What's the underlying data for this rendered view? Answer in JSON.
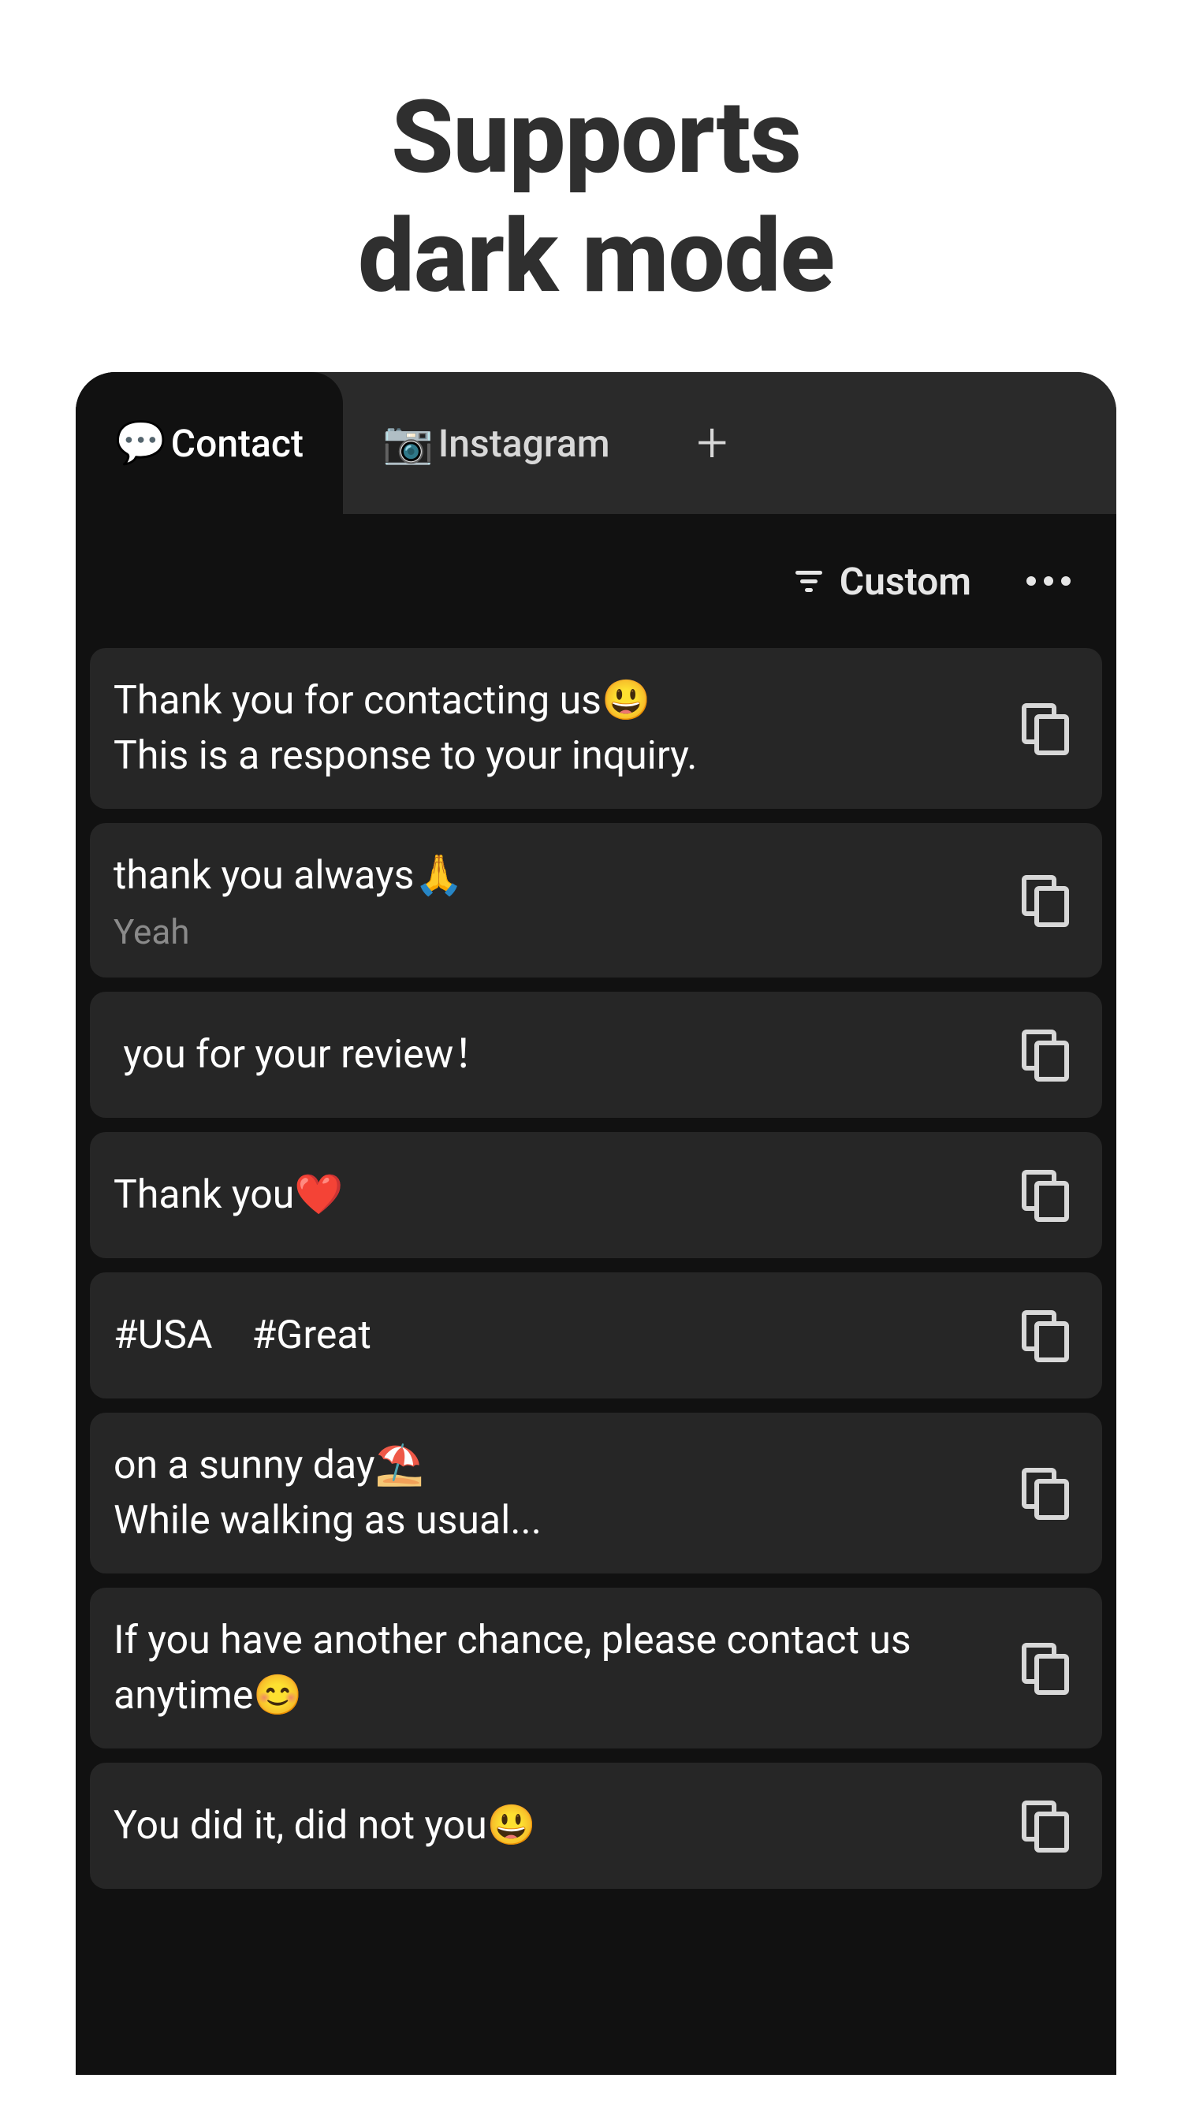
{
  "headline_line1": "Supports",
  "headline_line2": "dark mode",
  "tabs": [
    {
      "icon": "💬",
      "label": "Contact",
      "active": true
    },
    {
      "icon": "📷",
      "label": "Instagram",
      "active": false
    }
  ],
  "toolbar": {
    "filter_label": "Custom"
  },
  "items": [
    {
      "text": "Thank you for contacting us😃\nThis is a response to your inquiry.",
      "sub": null
    },
    {
      "text": "thank you always🙏",
      "sub": "Yeah"
    },
    {
      "text": " you for your review！",
      "sub": null
    },
    {
      "text": "Thank you❤️",
      "sub": null
    },
    {
      "text": "#USA　#Great",
      "sub": null
    },
    {
      "text": "on a sunny day⛱️\nWhile walking as usual...",
      "sub": null
    },
    {
      "text": "If you have another chance, please contact us anytime😊",
      "sub": null
    },
    {
      "text": "You did it, did not you😃",
      "sub": null
    }
  ]
}
